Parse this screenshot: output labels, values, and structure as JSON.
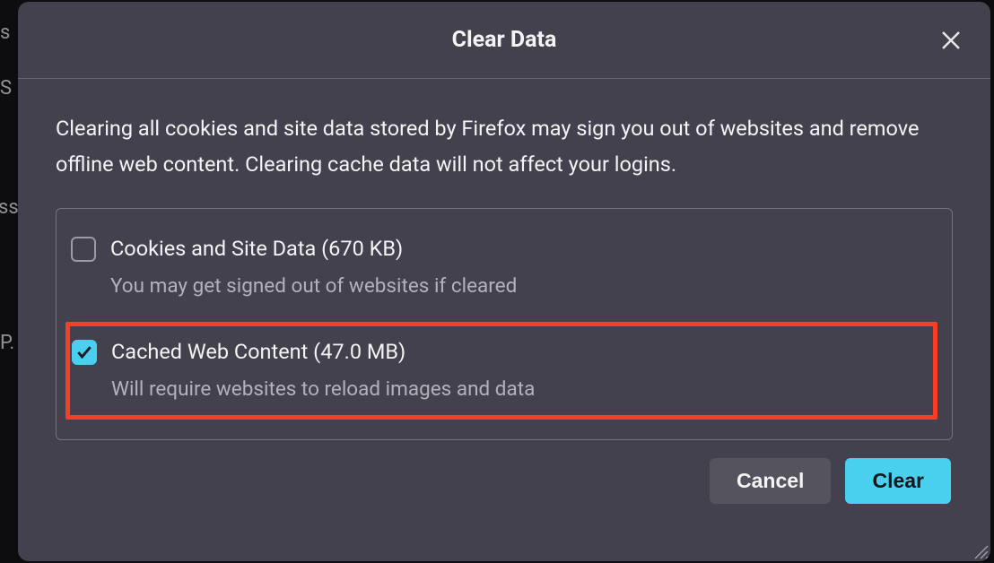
{
  "dialog": {
    "title": "Clear Data",
    "description": "Clearing all cookies and site data stored by Firefox may sign you out of websites and remove offline web content. Clearing cache data will not affect your logins.",
    "options": [
      {
        "label": "Cookies and Site Data (670 KB)",
        "sublabel": "You may get signed out of websites if cleared",
        "checked": false
      },
      {
        "label": "Cached Web Content (47.0 MB)",
        "sublabel": "Will require websites to reload images and data",
        "checked": true
      }
    ],
    "buttons": {
      "cancel": "Cancel",
      "clear": "Clear"
    }
  }
}
